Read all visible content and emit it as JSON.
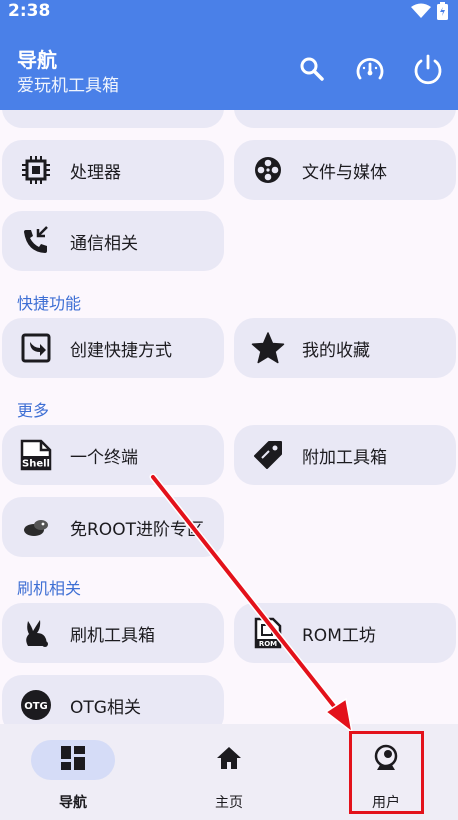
{
  "status_bar": {
    "time": "2:38",
    "icons": [
      "wifi-icon",
      "battery-icon"
    ]
  },
  "app_bar": {
    "title": "导航",
    "subtitle": "爱玩机工具箱",
    "actions": [
      "search-icon",
      "speedometer-icon",
      "power-icon"
    ]
  },
  "sections": {
    "row_cards": [
      {
        "label": "处理器",
        "icon": "cpu-icon"
      },
      {
        "label": "文件与媒体",
        "icon": "film-reel-icon"
      },
      {
        "label": "通信相关",
        "icon": "phone-forward-icon"
      }
    ],
    "shortcuts_title": "快捷功能",
    "shortcuts": [
      {
        "label": "创建快捷方式",
        "icon": "shortcut-icon"
      },
      {
        "label": "我的收藏",
        "icon": "star-icon"
      }
    ],
    "more_title": "更多",
    "more": [
      {
        "label": "一个终端",
        "icon": "shell-icon"
      },
      {
        "label": "附加工具箱",
        "icon": "tag-icon"
      },
      {
        "label": "免ROOT进阶专区",
        "icon": "cloud-bird-icon"
      }
    ],
    "flash_title": "刷机相关",
    "flash": [
      {
        "label": "刷机工具箱",
        "icon": "rabbit-icon"
      },
      {
        "label": "ROM工坊",
        "icon": "rom-chip-icon"
      },
      {
        "label": "OTG相关",
        "icon": "otg-icon"
      }
    ]
  },
  "bottom_nav": [
    {
      "label": "导航",
      "icon": "dashboard-icon",
      "active": true
    },
    {
      "label": "主页",
      "icon": "home-icon",
      "active": false
    },
    {
      "label": "用户",
      "icon": "user-icon",
      "active": false
    }
  ],
  "colors": {
    "primary": "#4a80e8",
    "background": "#fcf7fd",
    "card": "#e9e8f5",
    "section_title": "#3e6fd4",
    "annotation": "#e3121b"
  }
}
